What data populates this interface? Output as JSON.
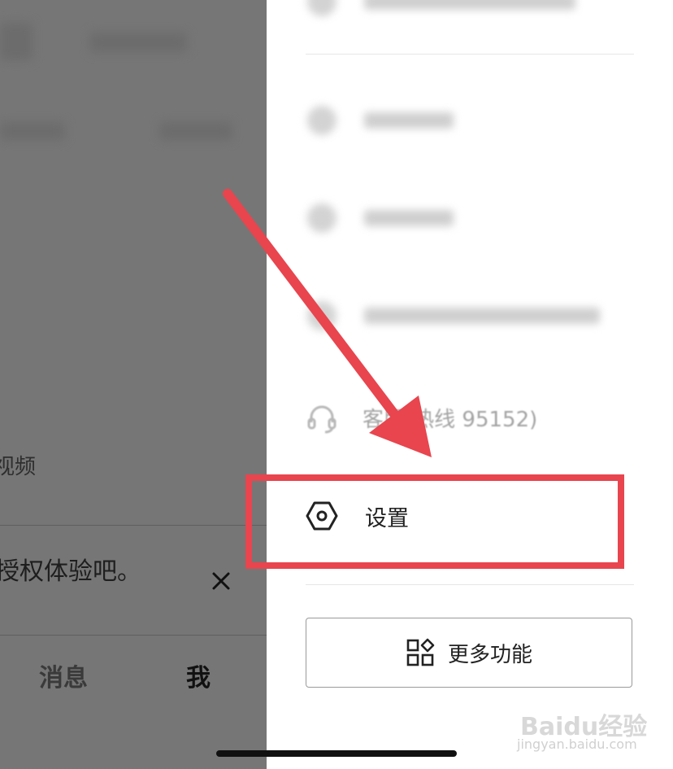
{
  "left_page": {
    "video_label": "视频",
    "banner_text": "授权体验吧。",
    "close_icon": "close-icon",
    "tabs": [
      {
        "label": "消息"
      },
      {
        "label": "我"
      }
    ]
  },
  "drawer": {
    "menu": [
      {
        "icon": "headset-icon",
        "label": "客服(热线 95152)"
      },
      {
        "icon": "hexagon-gear-icon",
        "label": "设置"
      }
    ],
    "more_button": {
      "icon": "apps-grid-icon",
      "label": "更多功能"
    }
  },
  "annotation": {
    "color": "#e8454e"
  },
  "watermark": {
    "logo": "Baidu经验",
    "url": "jingyan.baidu.com"
  }
}
